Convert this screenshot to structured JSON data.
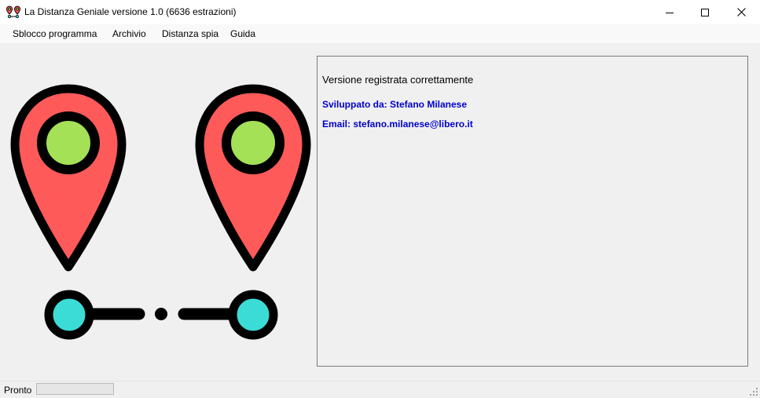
{
  "window": {
    "title": "La Distanza Geniale versione 1.0 (6636 estrazioni)",
    "icon": "map-pins-icon",
    "controls": [
      "minimize-icon",
      "maximize-icon",
      "close-icon"
    ]
  },
  "menu": {
    "items": [
      {
        "label": "Sblocco programma"
      },
      {
        "label": "Archivio"
      },
      {
        "label": "Distanza spia"
      },
      {
        "label": "Guida"
      }
    ]
  },
  "illustration": {
    "icon": "map-pins-distance-icon",
    "colors": {
      "pin_fill": "#ff5a5a",
      "pin_center": "#a4e157",
      "endpoint_fill": "#3cdcd6",
      "outline": "#000000"
    }
  },
  "info": {
    "status_message": "Versione registrata correttamente",
    "developer": "Sviluppato da: Stefano Milanese",
    "email": "Email: stefano.milanese@libero.it",
    "link_color": "#0000cc"
  },
  "statusbar": {
    "label": "Pronto",
    "progress": 0
  }
}
